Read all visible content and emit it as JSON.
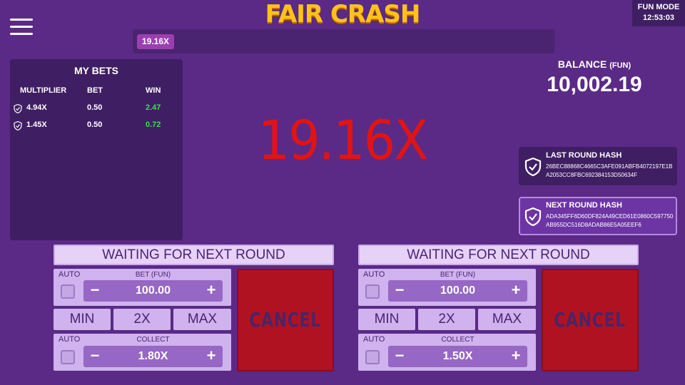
{
  "header": {
    "logo": "FAIR CRASH",
    "mode": "FUN MODE",
    "time": "12:53:03",
    "history": [
      "19.16X"
    ]
  },
  "my_bets": {
    "title": "MY BETS",
    "columns": [
      "MULTIPLIER",
      "BET",
      "WIN"
    ],
    "rows": [
      {
        "multiplier": "4.94X",
        "bet": "0.50",
        "win": "2.47"
      },
      {
        "multiplier": "1.45X",
        "bet": "0.50",
        "win": "0.72"
      }
    ]
  },
  "multiplier": "19.16X",
  "balance": {
    "label": "BALANCE",
    "unit": "(FUN)",
    "value": "10,002.19"
  },
  "last_hash": {
    "title": "LAST ROUND HASH",
    "value": "26BEC88868C4665C3AFE091ABFB4072197E1BA2053CC8FBC692384153D50634F"
  },
  "next_hash": {
    "title": "NEXT ROUND HASH",
    "value": "ADA345FF6D60DF824A49CED61E0860C597750AB955DC516D8ADAB86E5A05EEF6"
  },
  "panels": [
    {
      "status": "WAITING FOR NEXT ROUND",
      "auto_label": "AUTO",
      "bet_label": "BET (FUN)",
      "bet_value": "100.00",
      "min": "MIN",
      "double": "2X",
      "max": "MAX",
      "collect_label": "COLLECT",
      "collect_value": "1.80X",
      "cancel": "CANCEL"
    },
    {
      "status": "WAITING FOR NEXT ROUND",
      "auto_label": "AUTO",
      "bet_label": "BET (FUN)",
      "bet_value": "100.00",
      "min": "MIN",
      "double": "2X",
      "max": "MAX",
      "collect_label": "COLLECT",
      "collect_value": "1.50X",
      "cancel": "CANCEL"
    }
  ],
  "colors": {
    "background": "#5a2a86",
    "multiplier": "#e01414",
    "win": "#39e04c",
    "cancel": "#b01222",
    "logo": "#ffc21a"
  },
  "icons": {
    "menu": "hamburger-menu-icon",
    "shield": "shield-check-icon",
    "minus": "−",
    "plus": "+"
  }
}
